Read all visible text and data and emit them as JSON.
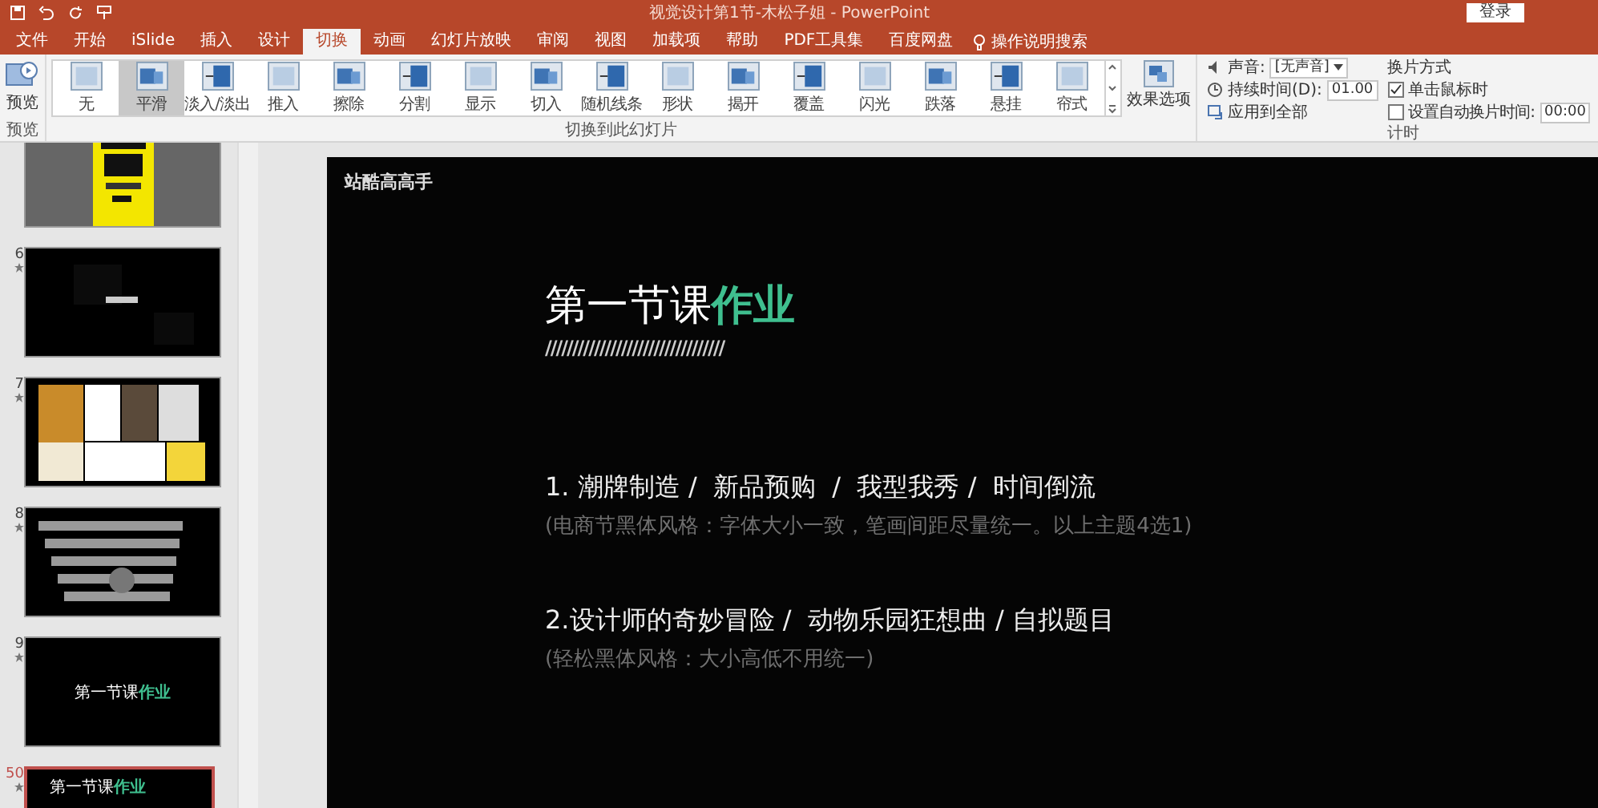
{
  "window": {
    "title": "视觉设计第1节-木松子姐 - PowerPoint",
    "login": "登录"
  },
  "tabs": [
    {
      "label": "文件",
      "selected": false
    },
    {
      "label": "开始",
      "selected": false
    },
    {
      "label": "iSlide",
      "selected": false
    },
    {
      "label": "插入",
      "selected": false
    },
    {
      "label": "设计",
      "selected": false
    },
    {
      "label": "切换",
      "selected": true
    },
    {
      "label": "动画",
      "selected": false
    },
    {
      "label": "幻灯片放映",
      "selected": false
    },
    {
      "label": "审阅",
      "selected": false
    },
    {
      "label": "视图",
      "selected": false
    },
    {
      "label": "加载项",
      "selected": false
    },
    {
      "label": "帮助",
      "selected": false
    },
    {
      "label": "PDF工具集",
      "selected": false
    },
    {
      "label": "百度网盘",
      "selected": false
    }
  ],
  "tell_me": "操作说明搜索",
  "ribbon": {
    "preview": {
      "label": "预览",
      "group": "预览"
    },
    "transitions": [
      {
        "label": "无",
        "selected": false
      },
      {
        "label": "平滑",
        "selected": true
      },
      {
        "label": "淡入/淡出",
        "selected": false
      },
      {
        "label": "推入",
        "selected": false
      },
      {
        "label": "擦除",
        "selected": false
      },
      {
        "label": "分割",
        "selected": false
      },
      {
        "label": "显示",
        "selected": false
      },
      {
        "label": "切入",
        "selected": false
      },
      {
        "label": "随机线条",
        "selected": false
      },
      {
        "label": "形状",
        "selected": false
      },
      {
        "label": "揭开",
        "selected": false
      },
      {
        "label": "覆盖",
        "selected": false
      },
      {
        "label": "闪光",
        "selected": false
      },
      {
        "label": "跌落",
        "selected": false
      },
      {
        "label": "悬挂",
        "selected": false
      },
      {
        "label": "帘式",
        "selected": false
      }
    ],
    "transitions_group": "切换到此幻灯片",
    "effect_options": "效果选项",
    "sound": {
      "label": "声音:",
      "value": "[无声音]"
    },
    "duration": {
      "label": "持续时间(D):",
      "value": "01.00"
    },
    "apply_all": "应用到全部",
    "advance": {
      "title": "换片方式",
      "on_click": {
        "label": "单击鼠标时",
        "checked": true
      },
      "after": {
        "label": "设置自动换片时间:",
        "checked": false,
        "value": "00:00"
      }
    },
    "timing_group": "计时"
  },
  "thumbnails": [
    {
      "kind": "poster",
      "selected": false
    },
    {
      "number": "6",
      "kind": "dark",
      "selected": false
    },
    {
      "number": "7",
      "kind": "collage",
      "selected": false
    },
    {
      "number": "8",
      "kind": "lettering",
      "selected": false
    },
    {
      "number": "9",
      "kind": "title",
      "title": "第一节课",
      "highlight": "作业",
      "selected": false
    },
    {
      "number": "50",
      "kind": "title_left",
      "title": "第一节课",
      "highlight": "作业",
      "selected": true
    }
  ],
  "slide": {
    "brand": "站酷高高手",
    "title": "第一节课",
    "title_highlight": "作业",
    "rule": "/////////////////////////////////",
    "items": [
      {
        "heading": "1. 潮牌制造 /  新品预购  /  我型我秀 /  时间倒流",
        "note": "(电商节黑体风格：字体大小一致，笔画间距尽量统一。以上主题4选1)"
      },
      {
        "heading": "2.设计师的奇妙冒险 /  动物乐园狂想曲 / 自拟题目",
        "note": "(轻松黑体风格：大小高低不用统一)"
      }
    ]
  }
}
